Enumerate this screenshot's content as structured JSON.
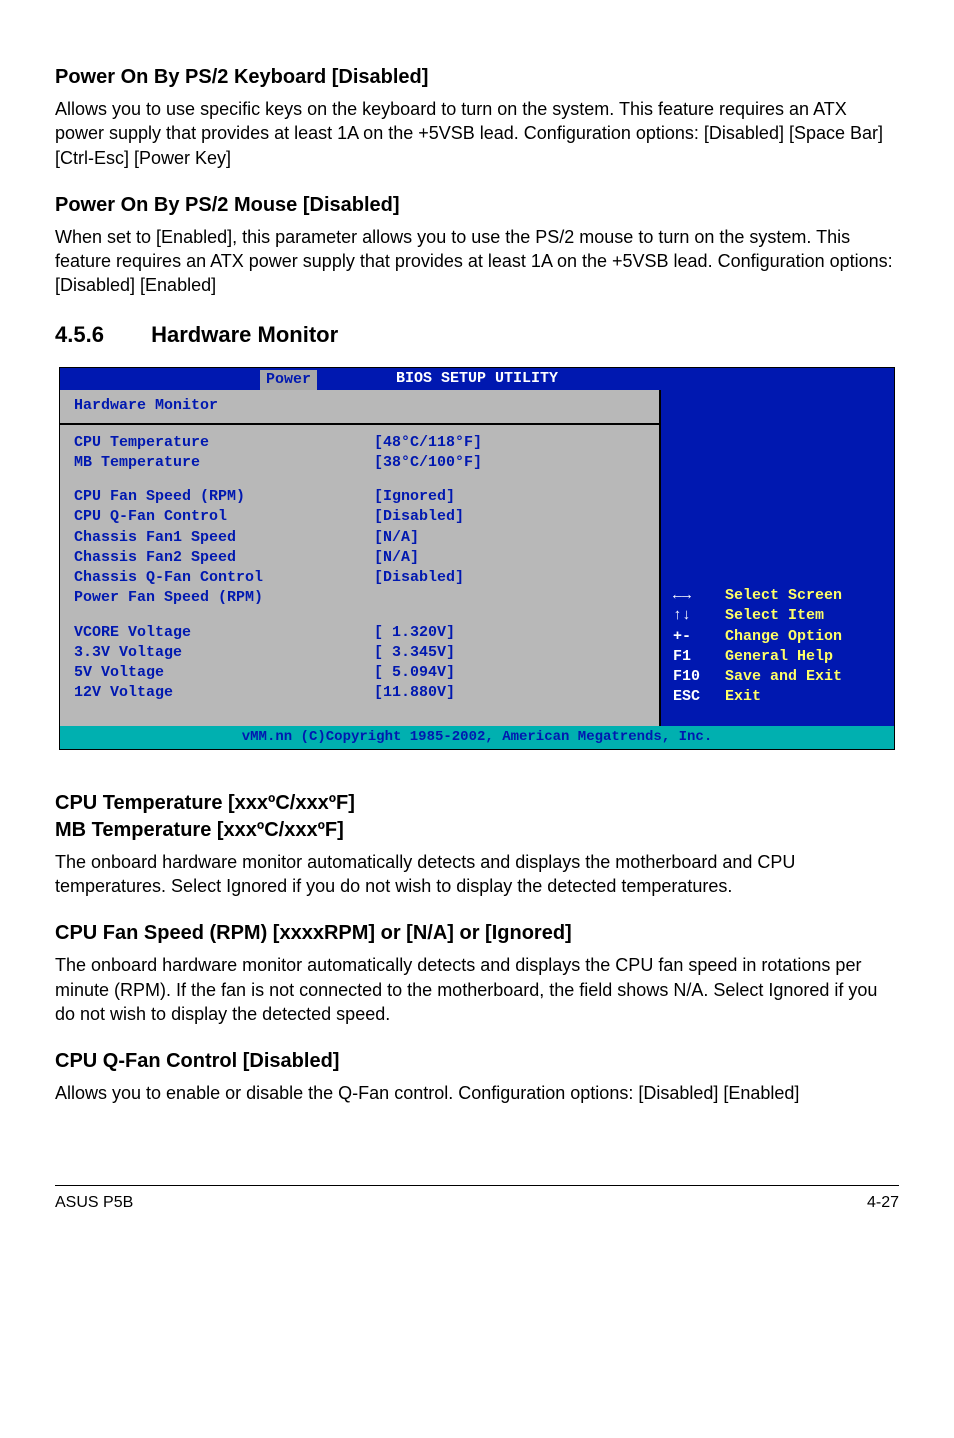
{
  "sections": {
    "powerKeyboard": {
      "heading": "Power On By PS/2 Keyboard [Disabled]",
      "body": "Allows you to use specific keys on the keyboard to turn on the system. This feature requires an ATX power supply that provides at least 1A on the +5VSB lead. Configuration options: [Disabled] [Space Bar] [Ctrl-Esc] [Power Key]"
    },
    "powerMouse": {
      "heading": "Power On By PS/2 Mouse [Disabled]",
      "body": "When set to [Enabled], this parameter allows you to use the PS/2 mouse to turn on the system. This feature requires an ATX power supply that provides at least 1A on the +5VSB lead. Configuration options: [Disabled] [Enabled]"
    },
    "hwmon": {
      "num": "4.5.6",
      "title": "Hardware Monitor"
    },
    "cpuTemp": {
      "heading1": "CPU Temperature [xxxºC/xxxºF]",
      "heading2": "MB Temperature [xxxºC/xxxºF]",
      "body": "The onboard hardware monitor automatically detects and displays the motherboard and CPU temperatures. Select Ignored if you do not wish to display the detected temperatures."
    },
    "fanSpeed": {
      "heading": "CPU Fan Speed (RPM) [xxxxRPM] or [N/A] or [Ignored]",
      "body": "The onboard hardware monitor automatically detects and displays the CPU fan speed in rotations per minute (RPM). If the fan is not connected to the motherboard, the field shows N/A. Select Ignored if you do not wish to display the detected speed."
    },
    "qfan": {
      "heading": "CPU Q-Fan Control [Disabled]",
      "body": "Allows you to enable or disable the Q-Fan control. Configuration options: [Disabled] [Enabled]"
    }
  },
  "bios": {
    "topTitle": "BIOS SETUP UTILITY",
    "tab": "Power",
    "panelTitle": "Hardware Monitor",
    "rows": [
      {
        "label": "CPU Temperature",
        "value": "[48°C/118°F]"
      },
      {
        "label": "MB Temperature",
        "value": "[38°C/100°F]"
      }
    ],
    "rows2": [
      {
        "label": "CPU Fan Speed (RPM)",
        "value": "[Ignored]"
      },
      {
        "label": "CPU Q-Fan Control",
        "value": "[Disabled]"
      },
      {
        "label": "Chassis Fan1 Speed",
        "value": "[N/A]"
      },
      {
        "label": "Chassis Fan2 Speed",
        "value": "[N/A]"
      },
      {
        "label": "Chassis Q-Fan Control",
        "value": "[Disabled]"
      },
      {
        "label": "Power Fan Speed (RPM)",
        "value": ""
      }
    ],
    "rows3": [
      {
        "label": "VCORE Voltage",
        "value": "[ 1.320V]"
      },
      {
        "label": "3.3V Voltage",
        "value": "[ 3.345V]"
      },
      {
        "label": "5V Voltage",
        "value": "[ 5.094V]"
      },
      {
        "label": "12V Voltage",
        "value": "[11.880V]"
      }
    ],
    "legend": [
      {
        "key": "←→",
        "desc": "Select Screen"
      },
      {
        "key": "↑↓",
        "desc": "Select Item"
      },
      {
        "key": "+-",
        "desc": "Change Option"
      },
      {
        "key": "F1",
        "desc": "General Help"
      },
      {
        "key": "F10",
        "desc": "Save and Exit"
      },
      {
        "key": "ESC",
        "desc": "Exit"
      }
    ],
    "footer": "vMM.nn (C)Copyright 1985-2002, American Megatrends, Inc."
  },
  "footer": {
    "left": "ASUS P5B",
    "right": "4-27"
  }
}
